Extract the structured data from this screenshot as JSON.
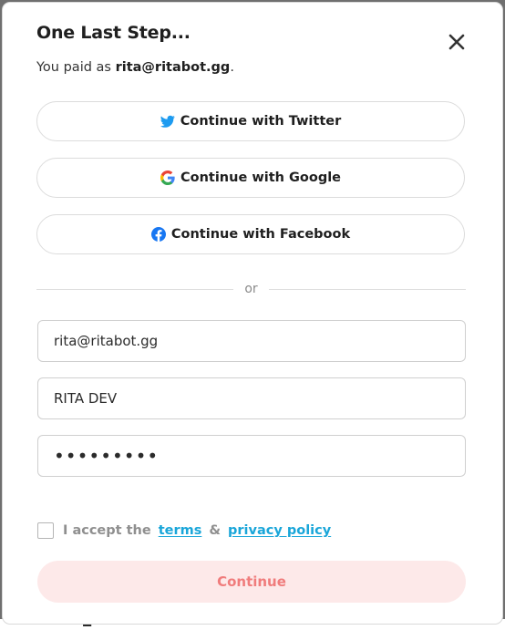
{
  "modal": {
    "title": "One Last Step...",
    "paid_prefix": "You paid as ",
    "paid_email": "rita@ritabot.gg",
    "paid_suffix": "."
  },
  "social": {
    "twitter_label": "Continue with Twitter",
    "google_label": "Continue with Google",
    "facebook_label": "Continue with Facebook"
  },
  "divider": {
    "label": "or"
  },
  "form": {
    "email_value": "rita@ritabot.gg",
    "name_value": "RITA DEV",
    "password_value": "ritabot12"
  },
  "terms": {
    "prefix": "I accept the",
    "terms_link": "terms",
    "amp": "&",
    "privacy_link": "privacy policy"
  },
  "continue_label": "Continue",
  "colors": {
    "accent_link": "#1aa6d9",
    "continue_bg": "#fde9e9",
    "continue_text": "#f07c7c",
    "twitter": "#1d9bf0",
    "facebook": "#1877f2"
  }
}
